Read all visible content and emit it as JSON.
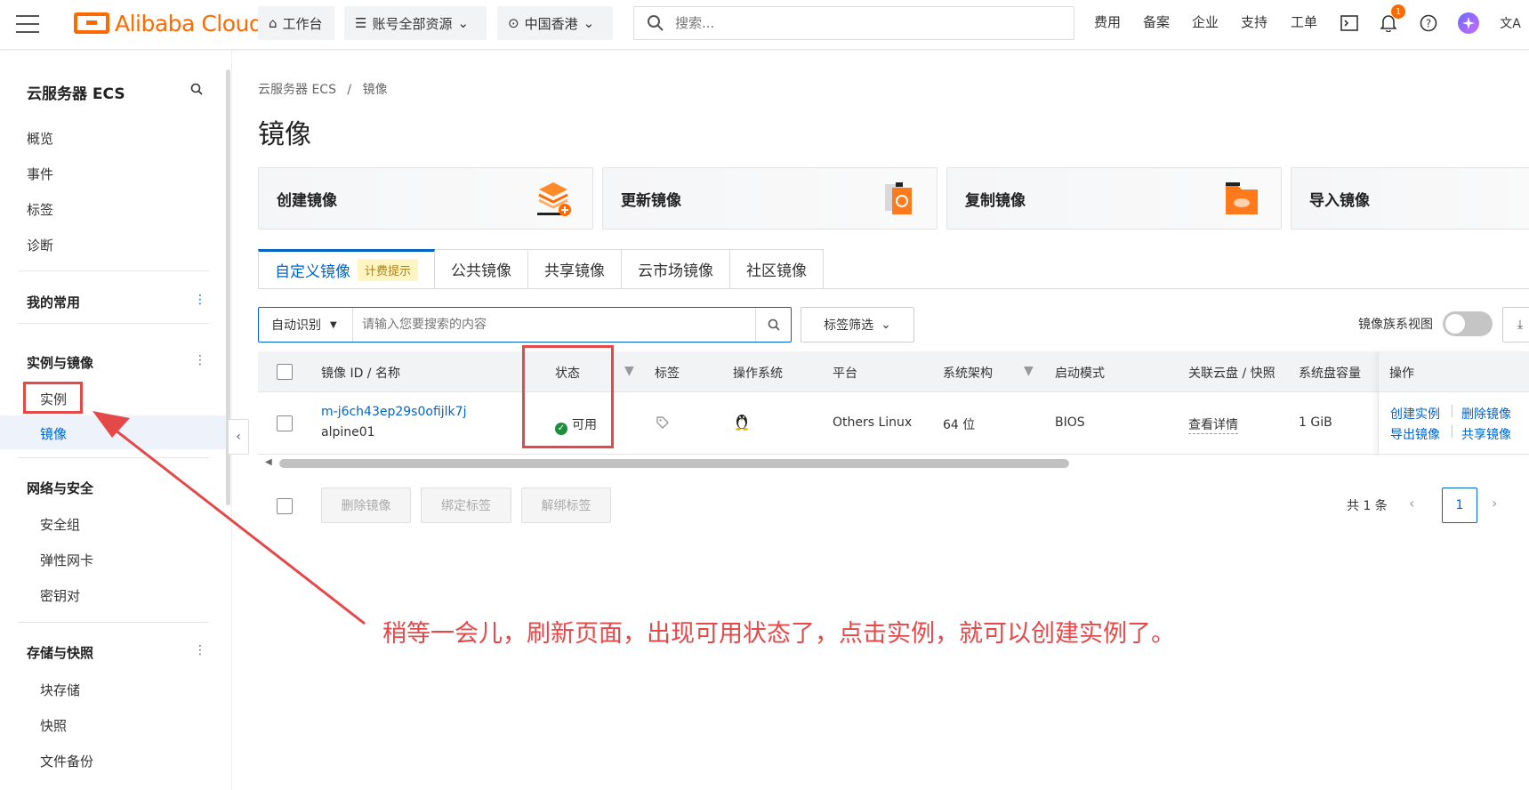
{
  "topbar": {
    "logo_text": "Alibaba Cloud",
    "workbench": "工作台",
    "account_resources": "账号全部资源",
    "region": "中国香港",
    "search_placeholder": "搜索...",
    "links": [
      "费用",
      "备案",
      "企业",
      "支持",
      "工单"
    ],
    "notification_count": "1",
    "icons": [
      "home-icon",
      "stack-icon",
      "location-icon",
      "search-icon",
      "terminal-icon",
      "bell-icon",
      "help-icon",
      "avatar",
      "language-icon"
    ]
  },
  "sidebar": {
    "title": "云服务器 ECS",
    "top_items": [
      "概览",
      "事件",
      "标签",
      "诊断"
    ],
    "groups": {
      "favorites": "我的常用",
      "instances_images": "实例与镜像",
      "instances": "实例",
      "images": "镜像",
      "network_security": "网络与安全",
      "security_group": "安全组",
      "eni": "弹性网卡",
      "keypair": "密钥对",
      "storage_snapshot": "存储与快照",
      "block_storage": "块存储",
      "snapshot": "快照",
      "file_backup": "文件备份"
    }
  },
  "breadcrumb": {
    "root": "云服务器 ECS",
    "sep": "/",
    "current": "镜像"
  },
  "page_title": "镜像",
  "cards": [
    "创建镜像",
    "更新镜像",
    "复制镜像",
    "导入镜像"
  ],
  "tabs": {
    "custom": "自定义镜像",
    "custom_tag": "计费提示",
    "public": "公共镜像",
    "shared": "共享镜像",
    "marketplace": "云市场镜像",
    "community": "社区镜像"
  },
  "filter": {
    "select": "自动识别",
    "placeholder": "请输入您要搜索的内容",
    "tag_filter": "标签筛选",
    "toggle_label": "镜像族系视图"
  },
  "table": {
    "headers": [
      "镜像 ID / 名称",
      "状态",
      "标签",
      "操作系统",
      "平台",
      "系统架构",
      "启动模式",
      "关联云盘 / 快照",
      "系统盘容量",
      "操作"
    ],
    "row": {
      "id": "m-j6ch43ep29s0ofijlk7j",
      "name": "alpine01",
      "status": "可用",
      "platform": "Others Linux",
      "arch": "64 位",
      "boot": "BIOS",
      "disk": "查看详情",
      "capacity": "1 GiB",
      "actions": [
        "创建实例",
        "删除镜像",
        "导出镜像",
        "共享镜像"
      ]
    }
  },
  "bottom": {
    "buttons": [
      "删除镜像",
      "绑定标签",
      "解绑标签"
    ],
    "total": "共 1 条",
    "page": "1"
  },
  "annotation": "稍等一会儿，刷新页面，出现可用状态了，点击实例，就可以创建实例了。",
  "colors": {
    "brand": "#ff6a00",
    "link": "#0064c8",
    "annotation": "#e54848",
    "status_ok": "#1e8e3e"
  }
}
